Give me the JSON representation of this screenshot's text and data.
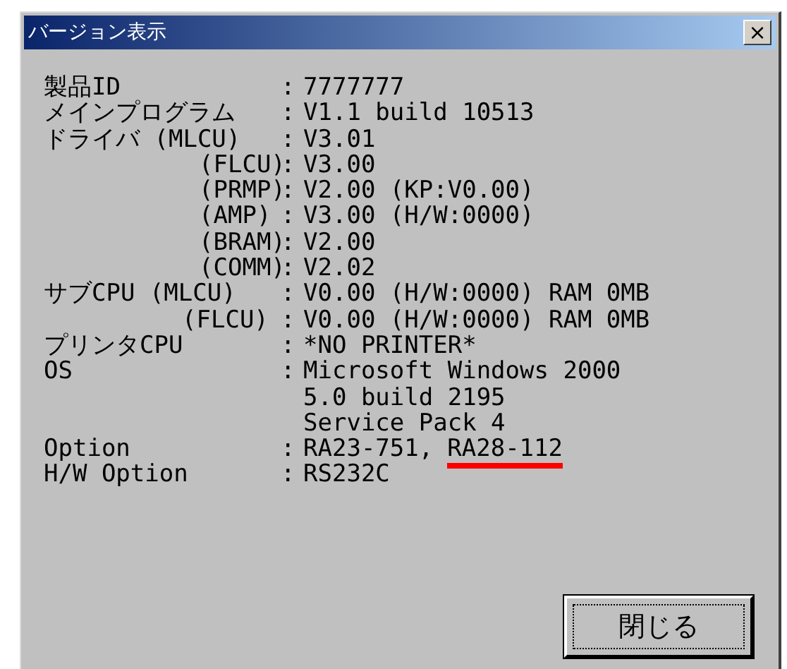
{
  "window": {
    "title": "バージョン表示",
    "close": "×"
  },
  "rows": [
    {
      "kind": "main",
      "label": "製品ID",
      "separator": ":",
      "value": [
        {
          "text": "7777777",
          "underlined": false
        }
      ]
    },
    {
      "kind": "main",
      "label": "メインプログラム",
      "separator": ":",
      "value": [
        {
          "text": "V1.1 build 10513",
          "underlined": false
        }
      ]
    },
    {
      "kind": "main",
      "label": "ドライバ (MLCU)",
      "separator": ":",
      "value": [
        {
          "text": "V3.01",
          "underlined": false
        }
      ]
    },
    {
      "kind": "sub",
      "label": "(FLCU)",
      "separator": ":",
      "value": [
        {
          "text": "V3.00",
          "underlined": false
        }
      ]
    },
    {
      "kind": "sub",
      "label": "(PRMP)",
      "separator": ":",
      "value": [
        {
          "text": "V2.00 (KP:V0.00)",
          "underlined": false
        }
      ]
    },
    {
      "kind": "sub",
      "label": "(AMP)",
      "separator": ":",
      "value": [
        {
          "text": "V3.00 (H/W:0000)",
          "underlined": false
        }
      ]
    },
    {
      "kind": "sub",
      "label": "(BRAM)",
      "separator": ":",
      "value": [
        {
          "text": "V2.00",
          "underlined": false
        }
      ]
    },
    {
      "kind": "sub",
      "label": "(COMM)",
      "separator": ":",
      "value": [
        {
          "text": "V2.02",
          "underlined": false
        }
      ]
    },
    {
      "kind": "main",
      "label": "サブCPU (MLCU)",
      "separator": ":",
      "value": [
        {
          "text": "V0.00 (H/W:0000) RAM 0MB",
          "underlined": false
        }
      ]
    },
    {
      "kind": "sub2",
      "label": "(FLCU)",
      "separator": ":",
      "value": [
        {
          "text": "V0.00 (H/W:0000) RAM 0MB",
          "underlined": false
        }
      ]
    },
    {
      "kind": "main",
      "label": "プリンタCPU",
      "separator": ":",
      "value": [
        {
          "text": "*NO PRINTER*",
          "underlined": false
        }
      ]
    },
    {
      "kind": "main",
      "label": "OS",
      "separator": ":",
      "value": [
        {
          "text": "Microsoft Windows 2000",
          "underlined": false
        }
      ]
    },
    {
      "kind": "cont",
      "value": [
        {
          "text": "5.0 build 2195",
          "underlined": false
        }
      ]
    },
    {
      "kind": "cont",
      "value": [
        {
          "text": "Service Pack 4",
          "underlined": false
        }
      ]
    },
    {
      "kind": "main",
      "label": "Option",
      "separator": ":",
      "value": [
        {
          "text": "RA23-751,",
          "underlined": false
        },
        {
          "text": "RA28-112",
          "underlined": true
        }
      ]
    },
    {
      "kind": "main",
      "label": "H/W Option",
      "separator": ":",
      "value": [
        {
          "text": "RS232C",
          "underlined": false
        }
      ]
    }
  ],
  "buttons": [
    {
      "label": "閉じる",
      "focused": true
    }
  ]
}
